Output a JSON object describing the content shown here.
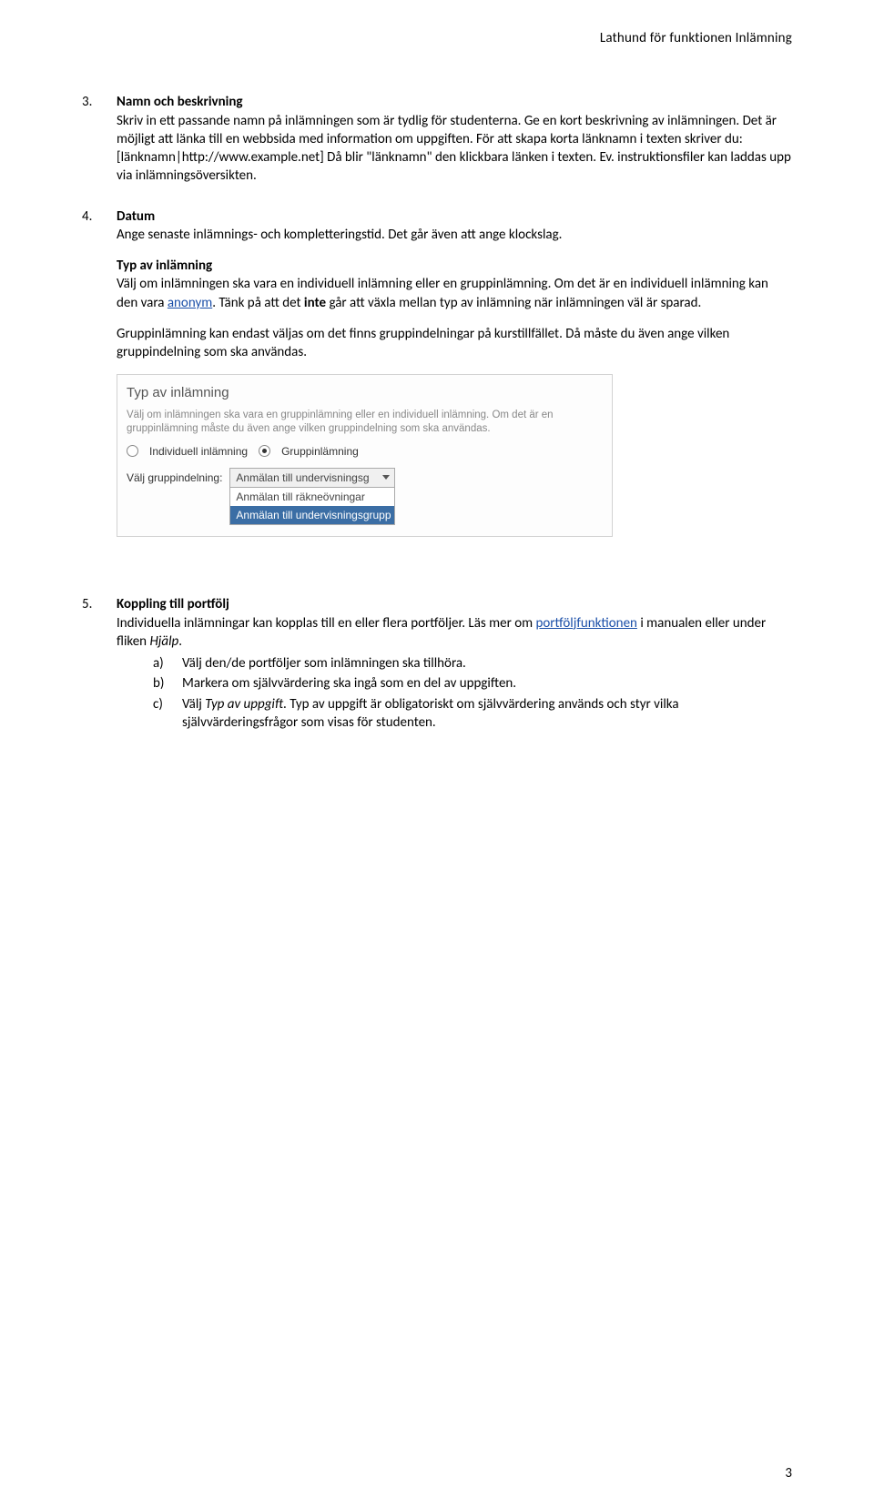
{
  "header": "Lathund för funktionen Inlämning",
  "section3": {
    "num": "3.",
    "title": "Namn och beskrivning",
    "text": "Skriv in ett passande namn på inlämningen som är tydlig för studenterna. Ge en kort beskrivning av inlämningen. Det är möjligt att länka till en webbsida med information om uppgiften. För att skapa korta länknamn i texten skriver du: [länknamn|http://www.example.net] Då blir \"länknamn\" den klickbara länken i texten. Ev. instruktionsfiler kan laddas upp via inlämningsöversikten."
  },
  "section4": {
    "num": "4.",
    "title": "Datum",
    "text1": "Ange senaste inlämnings- och kompletteringstid. Det går även att ange klockslag.",
    "typavinlamning_title": "Typ av inlämning",
    "p1a": "Välj om inlämningen ska vara en individuell inlämning eller en gruppinlämning. Om det är en individuell inlämning kan den vara ",
    "anonym": "anonym",
    "p1b": ". Tänk på att det ",
    "inte": "inte",
    "p1c": " går att växla mellan typ av inlämning när inlämningen väl är sparad.",
    "p2a": "Gruppinlämning kan endast väljas om det finns gruppindelningar på kurstillfället",
    "p2b": ". Då måste du även ange vilken gruppindelning som ska användas."
  },
  "ui": {
    "title": "Typ av inlämning",
    "desc": "Välj om inlämningen ska vara en gruppinlämning eller en individuell inlämning. Om det är en gruppinlämning måste du även ange vilken gruppindelning som ska användas.",
    "radio1": "Individuell inlämning",
    "radio2": "Gruppinlämning",
    "select_label": "Välj gruppindelning:",
    "selected": "Anmälan till undervisningsg",
    "opt1": "Anmälan till räkneövningar",
    "opt2": "Anmälan till undervisningsgrupp"
  },
  "section5": {
    "num": "5.",
    "title": "Koppling till portfölj",
    "p1a": "Individuella inlämningar kan kopplas till en eller flera portföljer. Läs mer om ",
    "link": "portföljfunktionen",
    "p1b": " i manualen eller under fliken ",
    "hjalp": "Hjälp",
    "p1c": ".",
    "a_letter": "a)",
    "a": "Välj den/de portföljer som inlämningen ska tillhöra.",
    "b_letter": "b)",
    "b": "Markera om självvärdering ska ingå som en del av uppgiften.",
    "c_letter": "c)",
    "c1": "Välj ",
    "c_typ": "Typ av uppgift",
    "c2": ". Typ av uppgift är obligatoriskt om självvärdering används och styr vilka självvärderingsfrågor som visas för studenten."
  },
  "page_number": "3"
}
